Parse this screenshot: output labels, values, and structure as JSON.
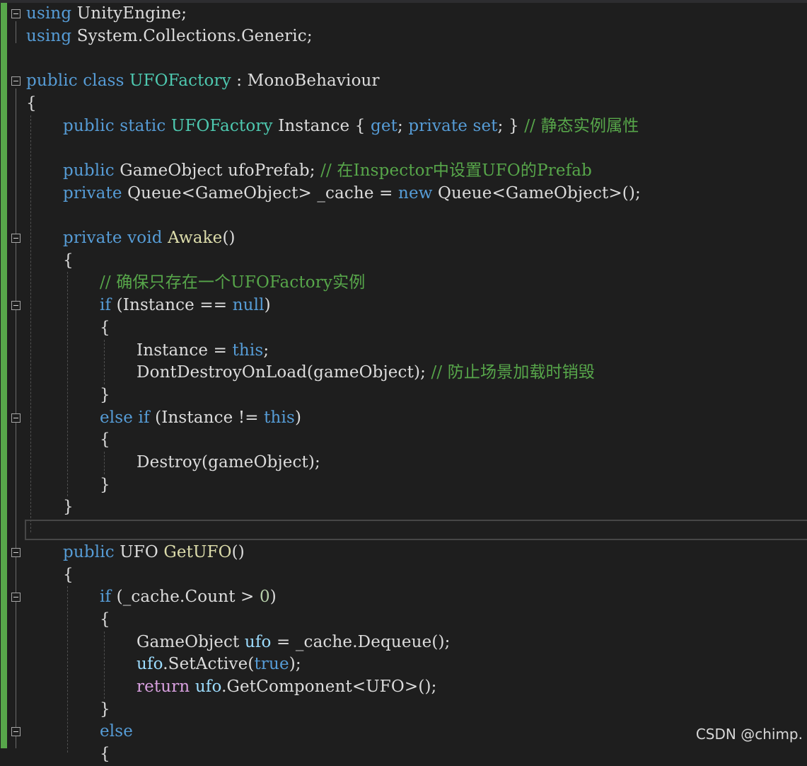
{
  "colors": {
    "background": "#1e1e1e",
    "keyword": "#569cd6",
    "control_keyword": "#d8a0df",
    "type": "#4ec9b0",
    "method": "#dcdcaa",
    "identifier": "#dcdcdc",
    "local_variable": "#9cdcfe",
    "comment": "#57a64a",
    "number": "#b5cea8",
    "change_bar": "#57a64a"
  },
  "editor": {
    "lines": [
      {
        "fold": true,
        "indent": 0,
        "tokens": [
          {
            "t": "using",
            "c": "keyword"
          },
          {
            "t": " UnityEngine;",
            "c": "identifier"
          }
        ]
      },
      {
        "fold": false,
        "indent": 0,
        "tokens": [
          {
            "t": "using",
            "c": "keyword"
          },
          {
            "t": " System.Collections.Generic;",
            "c": "identifier"
          }
        ]
      },
      {
        "fold": false,
        "indent": 0,
        "tokens": []
      },
      {
        "fold": true,
        "indent": 0,
        "tokens": [
          {
            "t": "public",
            "c": "keyword"
          },
          {
            "t": " ",
            "c": "identifier"
          },
          {
            "t": "class",
            "c": "keyword"
          },
          {
            "t": " ",
            "c": "identifier"
          },
          {
            "t": "UFOFactory",
            "c": "type"
          },
          {
            "t": " : MonoBehaviour",
            "c": "identifier"
          }
        ]
      },
      {
        "fold": false,
        "indent": 0,
        "tokens": [
          {
            "t": "{",
            "c": "identifier"
          }
        ]
      },
      {
        "fold": false,
        "indent": 1,
        "tokens": [
          {
            "t": "public",
            "c": "keyword"
          },
          {
            "t": " ",
            "c": "identifier"
          },
          {
            "t": "static",
            "c": "keyword"
          },
          {
            "t": " ",
            "c": "identifier"
          },
          {
            "t": "UFOFactory",
            "c": "type"
          },
          {
            "t": " Instance { ",
            "c": "identifier"
          },
          {
            "t": "get",
            "c": "keyword"
          },
          {
            "t": "; ",
            "c": "identifier"
          },
          {
            "t": "private",
            "c": "keyword"
          },
          {
            "t": " ",
            "c": "identifier"
          },
          {
            "t": "set",
            "c": "keyword"
          },
          {
            "t": "; } ",
            "c": "identifier"
          },
          {
            "t": "// 静态实例属性",
            "c": "comment"
          }
        ]
      },
      {
        "fold": false,
        "indent": 1,
        "tokens": []
      },
      {
        "fold": false,
        "indent": 1,
        "tokens": [
          {
            "t": "public",
            "c": "keyword"
          },
          {
            "t": " GameObject ufoPrefab; ",
            "c": "identifier"
          },
          {
            "t": "// 在Inspector中设置UFO的Prefab",
            "c": "comment"
          }
        ]
      },
      {
        "fold": false,
        "indent": 1,
        "tokens": [
          {
            "t": "private",
            "c": "keyword"
          },
          {
            "t": " Queue<GameObject> _cache = ",
            "c": "identifier"
          },
          {
            "t": "new",
            "c": "keyword"
          },
          {
            "t": " Queue<GameObject>();",
            "c": "identifier"
          }
        ]
      },
      {
        "fold": false,
        "indent": 1,
        "tokens": []
      },
      {
        "fold": true,
        "indent": 1,
        "tokens": [
          {
            "t": "private",
            "c": "keyword"
          },
          {
            "t": " ",
            "c": "identifier"
          },
          {
            "t": "void",
            "c": "keyword"
          },
          {
            "t": " ",
            "c": "identifier"
          },
          {
            "t": "Awake",
            "c": "method"
          },
          {
            "t": "()",
            "c": "identifier"
          }
        ]
      },
      {
        "fold": false,
        "indent": 1,
        "tokens": [
          {
            "t": "{",
            "c": "identifier"
          }
        ]
      },
      {
        "fold": false,
        "indent": 2,
        "tokens": [
          {
            "t": "// 确保只存在一个UFOFactory实例",
            "c": "comment"
          }
        ]
      },
      {
        "fold": true,
        "indent": 2,
        "tokens": [
          {
            "t": "if",
            "c": "keyword"
          },
          {
            "t": " (Instance == ",
            "c": "identifier"
          },
          {
            "t": "null",
            "c": "keyword"
          },
          {
            "t": ")",
            "c": "identifier"
          }
        ]
      },
      {
        "fold": false,
        "indent": 2,
        "tokens": [
          {
            "t": "{",
            "c": "identifier"
          }
        ]
      },
      {
        "fold": false,
        "indent": 3,
        "tokens": [
          {
            "t": "Instance = ",
            "c": "identifier"
          },
          {
            "t": "this",
            "c": "keyword"
          },
          {
            "t": ";",
            "c": "identifier"
          }
        ]
      },
      {
        "fold": false,
        "indent": 3,
        "tokens": [
          {
            "t": "DontDestroyOnLoad(gameObject); ",
            "c": "identifier"
          },
          {
            "t": "// 防止场景加载时销毁",
            "c": "comment"
          }
        ]
      },
      {
        "fold": false,
        "indent": 2,
        "tokens": [
          {
            "t": "}",
            "c": "identifier"
          }
        ]
      },
      {
        "fold": true,
        "indent": 2,
        "tokens": [
          {
            "t": "else",
            "c": "keyword"
          },
          {
            "t": " ",
            "c": "identifier"
          },
          {
            "t": "if",
            "c": "keyword"
          },
          {
            "t": " (Instance != ",
            "c": "identifier"
          },
          {
            "t": "this",
            "c": "keyword"
          },
          {
            "t": ")",
            "c": "identifier"
          }
        ]
      },
      {
        "fold": false,
        "indent": 2,
        "tokens": [
          {
            "t": "{",
            "c": "identifier"
          }
        ]
      },
      {
        "fold": false,
        "indent": 3,
        "tokens": [
          {
            "t": "Destroy(gameObject);",
            "c": "identifier"
          }
        ]
      },
      {
        "fold": false,
        "indent": 2,
        "tokens": [
          {
            "t": "}",
            "c": "identifier"
          }
        ]
      },
      {
        "fold": false,
        "indent": 1,
        "tokens": [
          {
            "t": "}",
            "c": "identifier"
          }
        ]
      },
      {
        "fold": false,
        "indent": 1,
        "current": true,
        "tokens": []
      },
      {
        "fold": true,
        "indent": 1,
        "tokens": [
          {
            "t": "public",
            "c": "keyword"
          },
          {
            "t": " UFO ",
            "c": "identifier"
          },
          {
            "t": "GetUFO",
            "c": "method"
          },
          {
            "t": "()",
            "c": "identifier"
          }
        ]
      },
      {
        "fold": false,
        "indent": 1,
        "tokens": [
          {
            "t": "{",
            "c": "identifier"
          }
        ]
      },
      {
        "fold": true,
        "indent": 2,
        "tokens": [
          {
            "t": "if",
            "c": "keyword"
          },
          {
            "t": " (_cache.Count > ",
            "c": "identifier"
          },
          {
            "t": "0",
            "c": "number"
          },
          {
            "t": ")",
            "c": "identifier"
          }
        ]
      },
      {
        "fold": false,
        "indent": 2,
        "tokens": [
          {
            "t": "{",
            "c": "identifier"
          }
        ]
      },
      {
        "fold": false,
        "indent": 3,
        "tokens": [
          {
            "t": "GameObject ",
            "c": "identifier"
          },
          {
            "t": "ufo",
            "c": "local_variable"
          },
          {
            "t": " = _cache.Dequeue();",
            "c": "identifier"
          }
        ]
      },
      {
        "fold": false,
        "indent": 3,
        "tokens": [
          {
            "t": "ufo",
            "c": "local_variable"
          },
          {
            "t": ".SetActive(",
            "c": "identifier"
          },
          {
            "t": "true",
            "c": "keyword"
          },
          {
            "t": ");",
            "c": "identifier"
          }
        ]
      },
      {
        "fold": false,
        "indent": 3,
        "tokens": [
          {
            "t": "return",
            "c": "control_keyword"
          },
          {
            "t": " ",
            "c": "identifier"
          },
          {
            "t": "ufo",
            "c": "local_variable"
          },
          {
            "t": ".GetComponent<UFO>();",
            "c": "identifier"
          }
        ]
      },
      {
        "fold": false,
        "indent": 2,
        "tokens": [
          {
            "t": "}",
            "c": "identifier"
          }
        ]
      },
      {
        "fold": true,
        "indent": 2,
        "tokens": [
          {
            "t": "else",
            "c": "keyword"
          }
        ]
      },
      {
        "fold": false,
        "indent": 2,
        "tokens": [
          {
            "t": "{",
            "c": "identifier"
          }
        ]
      }
    ]
  },
  "watermark": "CSDN @chimp."
}
